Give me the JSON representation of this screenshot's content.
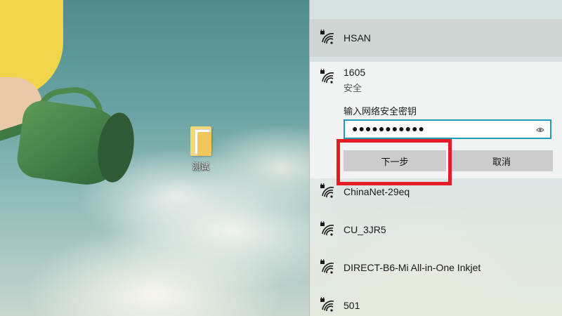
{
  "desktop": {
    "icon_label": "测试",
    "icon_name": "folder-icon"
  },
  "flyout": {
    "networks": [
      {
        "name": "HSAN",
        "icon": "wifi-secured-icon",
        "state": "hover"
      },
      {
        "name": "1605",
        "icon": "wifi-secured-icon",
        "state": "expanded",
        "security": "安全"
      },
      {
        "name": "ChinaNet-29eq",
        "icon": "wifi-secured-icon"
      },
      {
        "name": "CU_3JR5",
        "icon": "wifi-secured-icon"
      },
      {
        "name": "DIRECT-B6-Mi All-in-One Inkjet",
        "icon": "wifi-secured-icon"
      },
      {
        "name": "501",
        "icon": "wifi-secured-icon"
      }
    ],
    "connect_form": {
      "key_label": "输入网络安全密钥",
      "password_value": "●●●●●●●●●●●",
      "next_label": "下一步",
      "cancel_label": "取消"
    }
  },
  "colors": {
    "highlight_box": "#e41c24",
    "input_focus": "#1f9bb6",
    "button_bg": "#cccccc"
  }
}
